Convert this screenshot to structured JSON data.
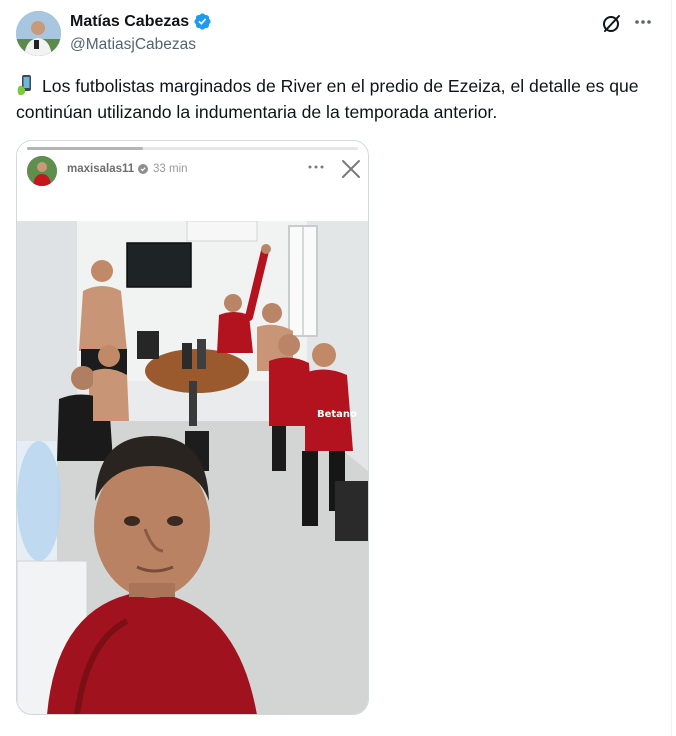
{
  "author": {
    "display_name": "Matías Cabezas",
    "handle": "@MatiasjCabezas",
    "verified_icon": "verified-badge-icon"
  },
  "actions": {
    "grok_icon": "grok-icon",
    "more_icon": "more-horizontal-icon"
  },
  "tweet": {
    "emoji_icon": "mobile-phone-icon",
    "text": "Los futbolistas marginados de River en el predio de Ezeiza, el detalle es que continúan utilizando la indumentaria de la temporada anterior."
  },
  "story": {
    "username": "maxisalas11",
    "time": "33 min",
    "progress": 0.35,
    "photo_description_icon": "team-selfie-photo"
  },
  "colors": {
    "verified": "#1d9bf0",
    "text": "#0f1419",
    "secondary": "#536471",
    "jersey_red": "#b3121f"
  }
}
